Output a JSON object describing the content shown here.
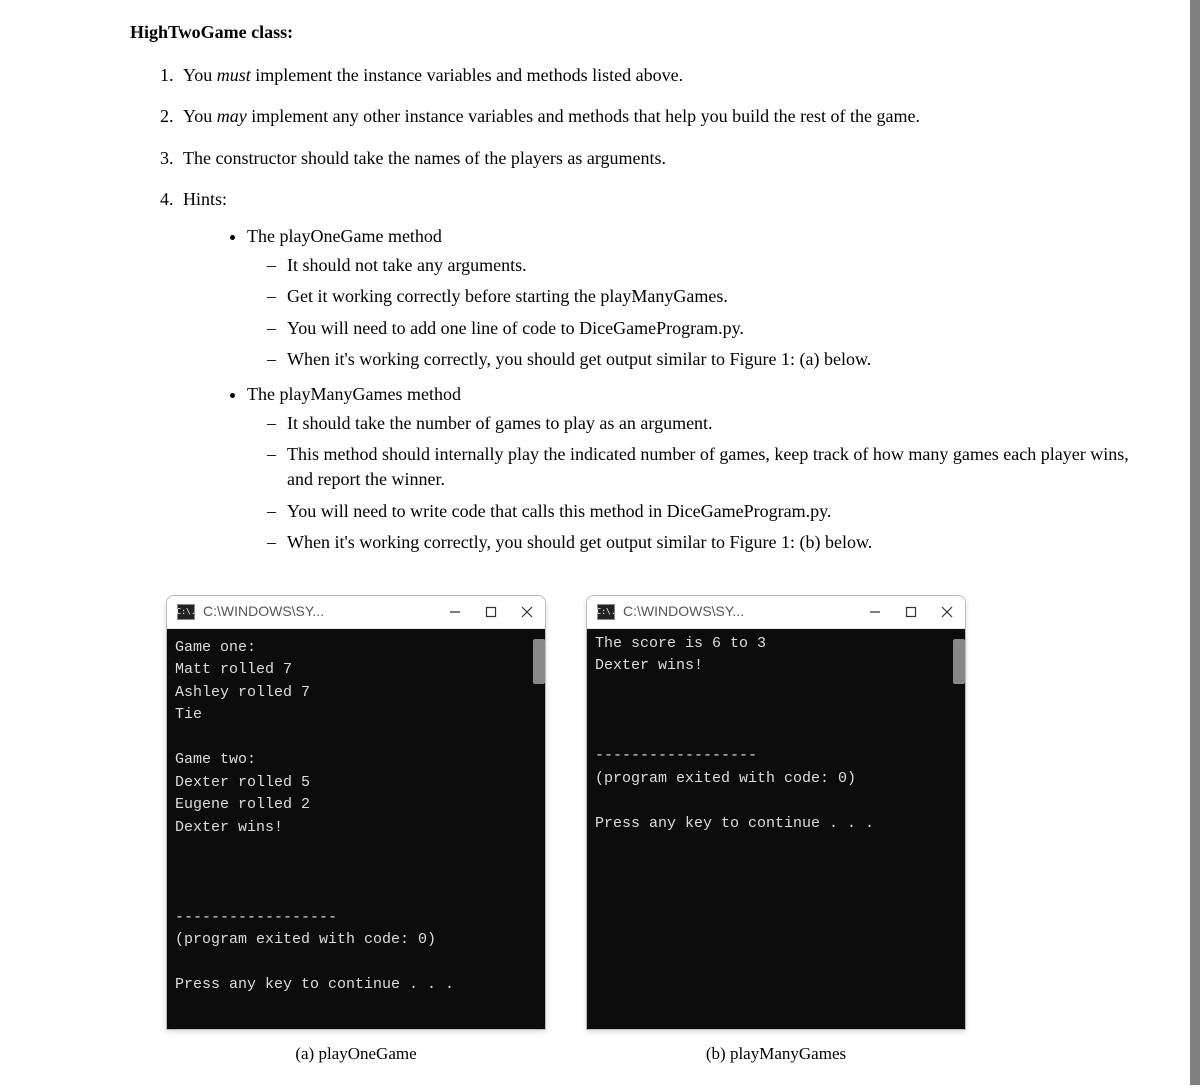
{
  "heading_prefix": "HighTwoGame class",
  "heading_suffix": ":",
  "list": {
    "item1_a": "You ",
    "item1_emph": "must",
    "item1_b": " implement the instance variables and methods listed above.",
    "item2_a": "You ",
    "item2_emph": "may",
    "item2_b": " implement any other instance variables and methods that help you build the rest of the game.",
    "item3": "The constructor should take the names of the players as arguments.",
    "item4": "Hints:"
  },
  "bullet1": {
    "label": "The playOneGame method",
    "d1": "It should not take any arguments.",
    "d2": "Get it working correctly before starting the playManyGames.",
    "d3": "You will need to add one line of code to DiceGameProgram.py.",
    "d4": "When it's working correctly, you should get output similar to Figure 1: (a) below."
  },
  "bullet2": {
    "label": "The playManyGames method",
    "d1": "It should take the number of games to play as an argument.",
    "d2": "This method should internally play the indicated number of games, keep track of how many games each player wins, and report the winner.",
    "d3": "You will need to write code that calls this method in DiceGameProgram.py.",
    "d4": "When it's working correctly, you should get output similar to Figure 1: (b) below."
  },
  "console_a": {
    "icon_text": "C:\\.",
    "title": "C:\\WINDOWS\\SY...",
    "body": "Game one:\nMatt rolled 7\nAshley rolled 7\nTie\n\nGame two:\nDexter rolled 5\nEugene rolled 2\nDexter wins!\n\n\n\n------------------\n(program exited with code: 0)\n\nPress any key to continue . . .",
    "caption": "(a) playOneGame"
  },
  "console_b": {
    "icon_text": "C:\\.",
    "title": "C:\\WINDOWS\\SY...",
    "body": "The score is 6 to 3\nDexter wins!\n\n\n\n------------------\n(program exited with code: 0)\n\nPress any key to continue . . .",
    "caption": "(b) playManyGames"
  }
}
